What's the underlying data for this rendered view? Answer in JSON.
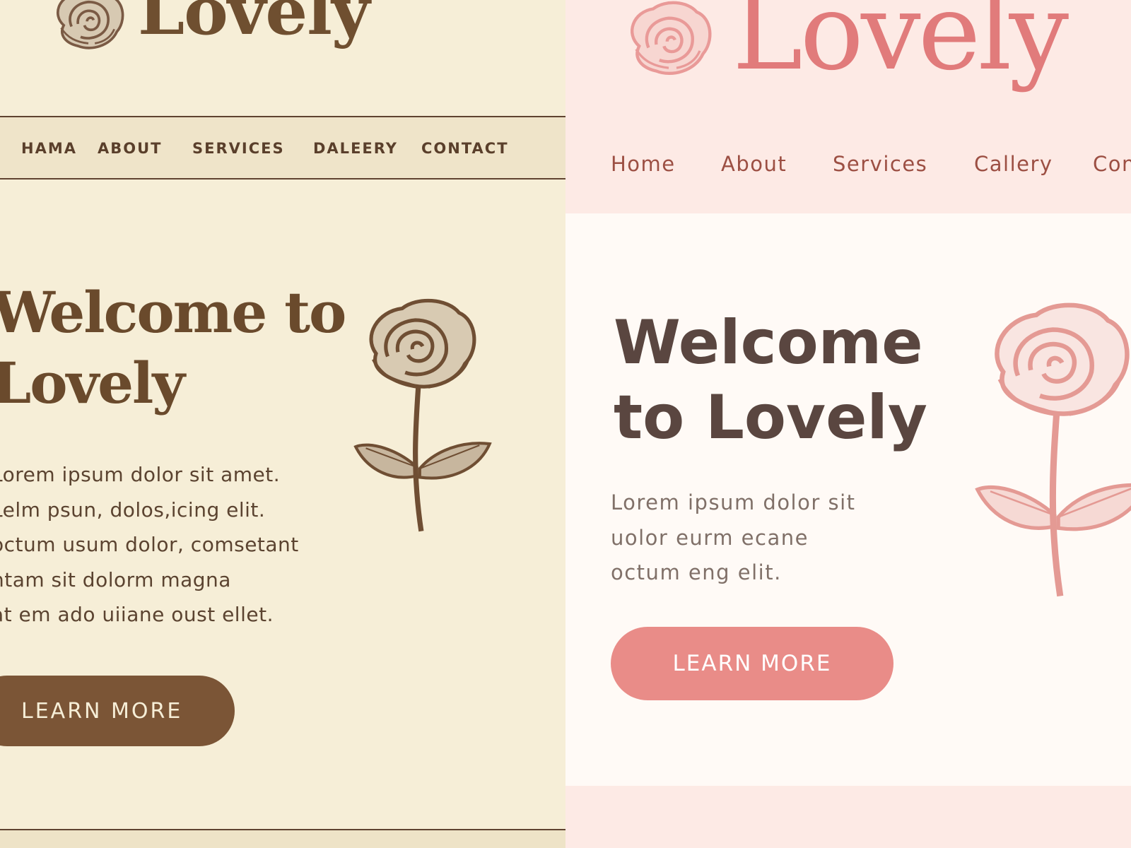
{
  "left_panel": {
    "logo": "Lovely",
    "nav": [
      "HAMA",
      "ABOUT",
      "SERVICES",
      "DALEERY",
      "CONTACT"
    ],
    "hero": {
      "title_line1": "Welcome to",
      "title_line2": "Lovely",
      "body_lines": [
        "Lorem ipsum dolor sit amet.",
        "Lelm psun, dolos,icing elit.",
        "octum usum dolor, comsetant",
        "ntam sit dolorm magna",
        "at em ado uiiane oust ellet."
      ],
      "button_label": "LEARN MORE"
    },
    "colors": {
      "background": "#f6eed7",
      "text": "#6a4a2c",
      "accent": "#7b5536"
    }
  },
  "right_panel": {
    "logo": "Lovely",
    "nav": [
      "Home",
      "About",
      "Services",
      "Callery",
      "Con"
    ],
    "hero": {
      "title_line1": "Welcome",
      "title_line2": "to Lovely",
      "body_lines": [
        "Lorem ipsum dolor sit",
        "uolor  eurm ecane",
        "octum eng elit."
      ],
      "button_label": "LEARN MORE"
    },
    "colors": {
      "background": "#fdeae5",
      "card": "#fffaf6",
      "logo": "#e17b7b",
      "accent": "#e98c88"
    }
  },
  "icons": {
    "logo": "rose-icon",
    "illustration": "rose-illustration"
  }
}
